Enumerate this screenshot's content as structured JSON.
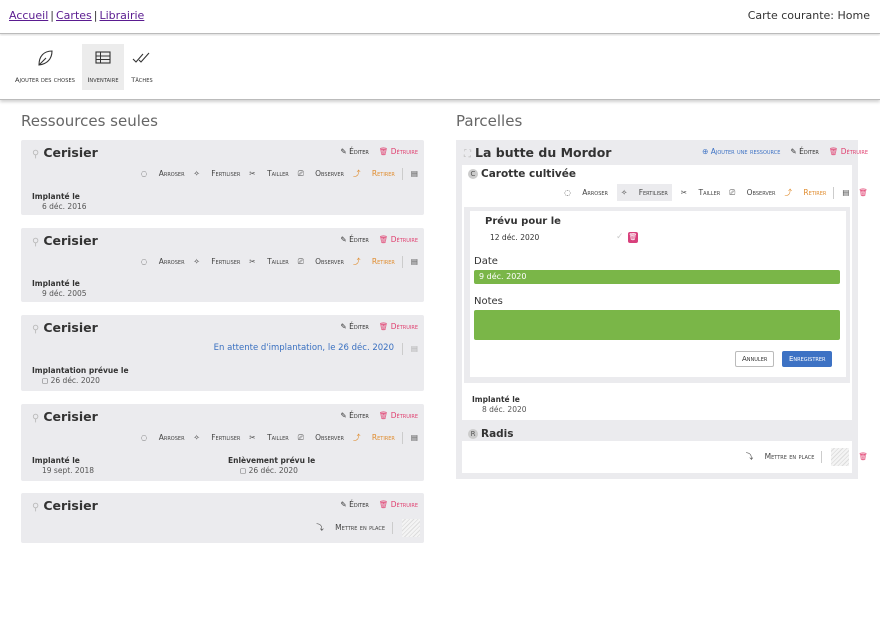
{
  "nav": {
    "crumbs": [
      "Accueil",
      "Cartes",
      "Librairie"
    ],
    "current_map": "Carte courante: Home"
  },
  "toolbar": {
    "items": [
      {
        "label": "Ajouter des choses",
        "icon": "leaf-icon"
      },
      {
        "label": "Inventaire",
        "icon": "table-icon",
        "active": true
      },
      {
        "label": "Tâches",
        "icon": "double-check-icon"
      }
    ]
  },
  "left": {
    "title": "Ressources seules",
    "cards": [
      {
        "name": "Cerisier",
        "info": [
          {
            "label": "Implanté le",
            "value": "6 déc. 2016"
          }
        ]
      },
      {
        "name": "Cerisier",
        "info": [
          {
            "label": "Implanté le",
            "value": "9 déc. 2005"
          }
        ]
      },
      {
        "name": "Cerisier",
        "pending": "En attente d'implantation, le 26 déc. 2020",
        "info": [
          {
            "label": "Implantation prévue le",
            "value": "26 déc. 2020"
          }
        ]
      },
      {
        "name": "Cerisier",
        "info": [
          {
            "label": "Implanté le",
            "value": "19 sept. 2018"
          },
          {
            "label": "Enlèvement prévu le",
            "value": "26 déc. 2020"
          }
        ]
      },
      {
        "name": "Cerisier",
        "place_label": "Mettre en place"
      }
    ]
  },
  "actions": {
    "edit": "Éditer",
    "destroy": "Détruire",
    "water": "Arroser",
    "fertilize": "Fertiliser",
    "prune": "Tailler",
    "observe": "Observer",
    "remove": "Retirer",
    "add_resource": "Ajouter une ressource",
    "place": "Mettre en place"
  },
  "right": {
    "title": "Parcelles",
    "plot_name": "La butte du Mordor",
    "resource1": {
      "letter": "C",
      "name": "Carotte cultivée",
      "planned_label": "Prévu pour le",
      "planned_value": "12 déc. 2020",
      "date_label": "Date",
      "date_value": "9 déc. 2020",
      "notes_label": "Notes",
      "cancel": "Annuler",
      "save": "Enregistrer",
      "implanted_label": "Implanté le",
      "implanted_value": "8 déc. 2020"
    },
    "resource2": {
      "letter": "R",
      "name": "Radis"
    }
  },
  "colors": {
    "accent_blue": "#3d72c4",
    "destroy_pink": "#e04070",
    "retirer_orange": "#e08c2e",
    "green_field": "#7ab648",
    "card_bg": "#ebebee"
  }
}
